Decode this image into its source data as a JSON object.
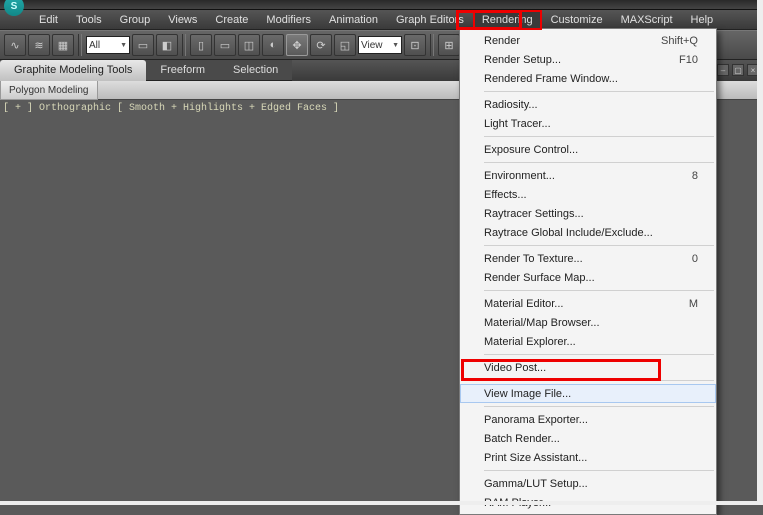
{
  "app_logo_glyph": "S",
  "menu": {
    "items": [
      "Edit",
      "Tools",
      "Group",
      "Views",
      "Create",
      "Modifiers",
      "Animation",
      "Graph Editors",
      "Rendering",
      "Customize",
      "MAXScript",
      "Help"
    ],
    "selected_index": 8
  },
  "toolbar": {
    "combo1": "All",
    "combo2": "View"
  },
  "ribbon": {
    "tabs": [
      "Graphite Modeling Tools",
      "Freeform",
      "Selection"
    ],
    "active_index": 0,
    "sub_tab": "Polygon Modeling"
  },
  "viewport": {
    "label": "[ + ] Orthographic [ Smooth + Highlights + Edged Faces ]"
  },
  "dropdown": {
    "groups": [
      [
        {
          "label": "Render",
          "shortcut": "Shift+Q"
        },
        {
          "label": "Render Setup...",
          "shortcut": "F10"
        },
        {
          "label": "Rendered Frame Window..."
        }
      ],
      [
        {
          "label": "Radiosity..."
        },
        {
          "label": "Light Tracer..."
        }
      ],
      [
        {
          "label": "Exposure Control..."
        }
      ],
      [
        {
          "label": "Environment...",
          "shortcut": "8"
        },
        {
          "label": "Effects..."
        },
        {
          "label": "Raytracer Settings..."
        },
        {
          "label": "Raytrace Global Include/Exclude..."
        }
      ],
      [
        {
          "label": "Render To Texture...",
          "shortcut": "0"
        },
        {
          "label": "Render Surface Map..."
        }
      ],
      [
        {
          "label": "Material Editor...",
          "shortcut": "M"
        },
        {
          "label": "Material/Map Browser..."
        },
        {
          "label": "Material Explorer..."
        }
      ],
      [
        {
          "label": "Video Post..."
        }
      ],
      [
        {
          "label": "View Image File...",
          "hover": true
        }
      ],
      [
        {
          "label": "Panorama Exporter..."
        },
        {
          "label": "Batch Render..."
        },
        {
          "label": "Print Size Assistant..."
        }
      ],
      [
        {
          "label": "Gamma/LUT Setup..."
        },
        {
          "label": "RAM Player..."
        }
      ]
    ]
  }
}
